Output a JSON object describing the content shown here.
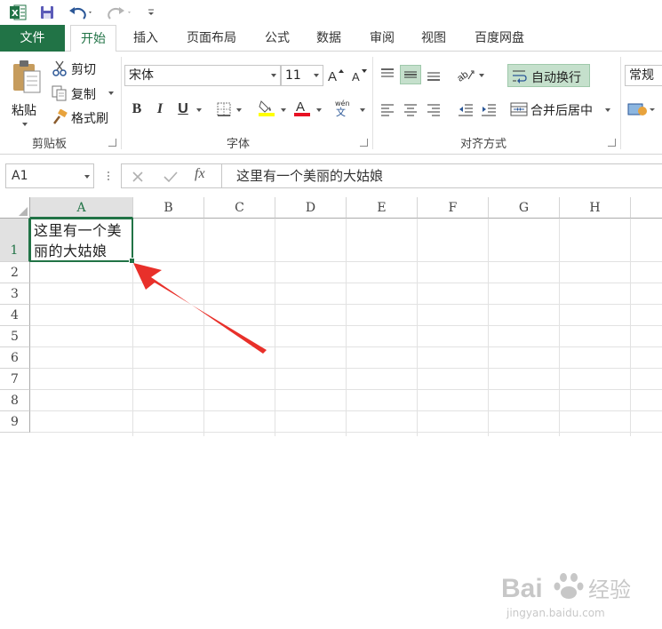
{
  "quick_access": {
    "icons": [
      "excel-logo-icon",
      "save-icon",
      "undo-icon",
      "redo-icon",
      "customize-icon"
    ]
  },
  "tabs": [
    {
      "label": "文件"
    },
    {
      "label": "开始"
    },
    {
      "label": "插入"
    },
    {
      "label": "页面布局"
    },
    {
      "label": "公式"
    },
    {
      "label": "数据"
    },
    {
      "label": "审阅"
    },
    {
      "label": "视图"
    },
    {
      "label": "百度网盘"
    }
  ],
  "clipboard": {
    "paste_label": "粘贴",
    "cut_label": "剪切",
    "copy_label": "复制",
    "format_painter_label": "格式刷",
    "group_label": "剪贴板"
  },
  "font": {
    "font_name": "宋体",
    "font_size": "11",
    "group_label": "字体",
    "bold": "B",
    "italic": "I",
    "underline": "U",
    "font_color_glyph": "A",
    "phonetic_glyph": "wén",
    "highlight_color": "#ffff00",
    "font_color": "#e81123"
  },
  "alignment": {
    "wrap_text_label": "自动换行",
    "merge_center_label": "合并后居中",
    "group_label": "对齐方式"
  },
  "number": {
    "format_label": "常规"
  },
  "formula_bar": {
    "name_box": "A1",
    "fx_label": "fx",
    "content": "这里有一个美丽的大姑娘"
  },
  "sheet": {
    "columns": [
      "A",
      "B",
      "C",
      "D",
      "E",
      "F",
      "G",
      "H"
    ],
    "rows": [
      "1",
      "2",
      "3",
      "4",
      "5",
      "6",
      "7",
      "8",
      "9"
    ],
    "active_cell_text": "这里有一个美丽的大姑娘"
  },
  "watermark": {
    "brand_text": "Bai",
    "brand_suffix": "经验",
    "url_text": "jingyan.baidu.com"
  },
  "colors": {
    "accent": "#217346",
    "arrow": "#e8302a"
  }
}
